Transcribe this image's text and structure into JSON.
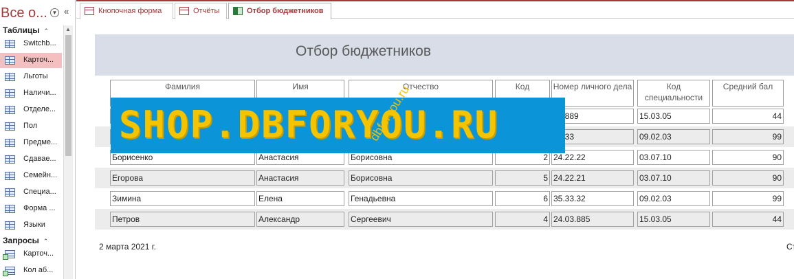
{
  "nav": {
    "title": "Все о...",
    "groups": [
      {
        "label": "Таблицы"
      },
      {
        "label": "Запросы"
      }
    ],
    "tables": [
      "Switchb...",
      "Карточ...",
      "Льготы",
      "Наличи...",
      "Отделе...",
      "Пол",
      "Предме...",
      "Сдавае...",
      "Семейн...",
      "Специа...",
      "Форма ...",
      "Языки"
    ],
    "queries": [
      "Карточ...",
      "Кол аб..."
    ],
    "selected_index": 1
  },
  "tabs": [
    {
      "label": "Кнопочная форма"
    },
    {
      "label": "Отчёты"
    },
    {
      "label": "Отбор бюджетников",
      "active": true
    }
  ],
  "report": {
    "title": "Отбор бюджетников",
    "columns": [
      "Фамилия",
      "Имя",
      "Отчество",
      "Код",
      "Номер личного дела",
      "Код специальности",
      "Средний бал"
    ],
    "rows": [
      [
        "",
        "",
        "",
        "",
        "03.889",
        "15.03.05",
        "44"
      ],
      [
        "",
        "",
        "",
        "",
        "33.33",
        "09.02.03",
        "99"
      ],
      [
        "Борисенко",
        "Анастасия",
        "Борисовна",
        "2",
        "24.22.22",
        "03.07.10",
        "90"
      ],
      [
        "Егорова",
        "Анастасия",
        "Борисовна",
        "5",
        "24.22.21",
        "03.07.10",
        "90"
      ],
      [
        "Зимина",
        "Елена",
        "Генадьевна",
        "6",
        "35.33.32",
        "09.02.03",
        "99"
      ],
      [
        "Петров",
        "Александр",
        "Сергеевич",
        "4",
        "24.03.885",
        "15.03.05",
        "44"
      ]
    ],
    "date": "2 марта 2021 г.",
    "page_label": "Ст"
  },
  "watermark": {
    "text": "SHOP.DBFORYOU.RU",
    "diagonal": "dbforyou.ru"
  },
  "colors": {
    "accent": "#a4373a",
    "header_band": "#d8dde8",
    "alt_row": "#ececec",
    "watermark_bg": "#0b95d8",
    "watermark_fg": "#f5c400"
  }
}
